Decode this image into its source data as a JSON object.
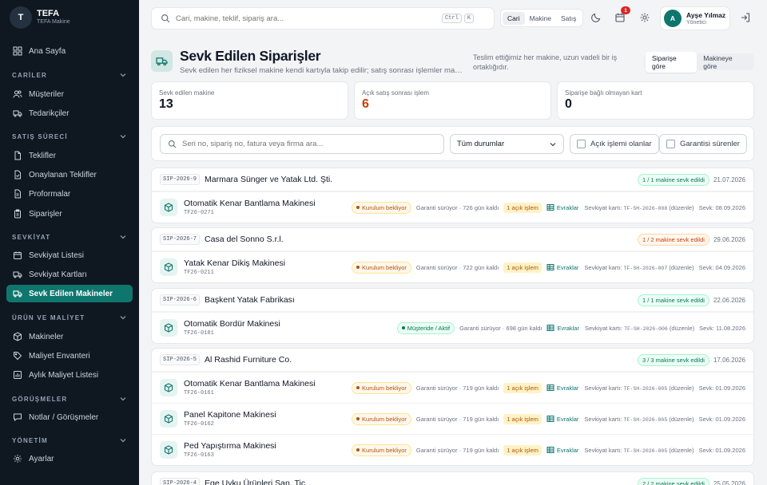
{
  "brand": {
    "logo": "T",
    "name": "TEFA",
    "sub": "TEFA Makine"
  },
  "sidebar": {
    "home": "Ana Sayfa",
    "sections": [
      {
        "title": "CARİLER",
        "items": [
          "Müşteriler",
          "Tedarikçiler"
        ]
      },
      {
        "title": "SATIŞ SÜRECİ",
        "items": [
          "Teklifler",
          "Onaylanan Teklifler",
          "Proformalar",
          "Siparişler"
        ]
      },
      {
        "title": "SEVKİYAT",
        "items": [
          "Sevkiyat Listesi",
          "Sevkiyat Kartları",
          "Sevk Edilen Makineler"
        ]
      },
      {
        "title": "ÜRÜN VE MALİYET",
        "items": [
          "Makineler",
          "Maliyet Envanteri",
          "Aylık Maliyet Listesi"
        ]
      },
      {
        "title": "GÖRÜŞMELER",
        "items": [
          "Notlar / Görüşmeler"
        ]
      },
      {
        "title": "YÖNETİM",
        "items": [
          "Ayarlar"
        ]
      }
    ],
    "active": "Sevk Edilen Makineler"
  },
  "topbar": {
    "search_placeholder": "Cari, makine, teklif, sipariş ara...",
    "kbd": [
      "Ctrl",
      "K"
    ],
    "scopes": [
      "Cari",
      "Makine",
      "Satış"
    ],
    "notifications": "1",
    "user": {
      "initial": "A",
      "name": "Ayşe Yılmaz",
      "role": "Yönetici"
    }
  },
  "page": {
    "title": "Sevk Edilen Siparişler",
    "subtitle": "Sevk edilen her fiziksel makine kendi kartıyla takip edilir; satış sonrası işlemler makine ...",
    "note": "Teslim ettiğimiz her makine, uzun vadeli bir iş ortaklığıdır.",
    "view_toggle": [
      "Siparişe göre",
      "Makineye göre"
    ]
  },
  "stats": [
    {
      "label": "Sevk edilen makine",
      "value": "13",
      "color": "#111827"
    },
    {
      "label": "Açık satış sonrası işlem",
      "value": "6",
      "color": "#c2410c"
    },
    {
      "label": "Siparişe bağlı olmayan kart",
      "value": "0",
      "color": "#111827"
    }
  ],
  "filters": {
    "search_placeholder": "Seri no, sipariş no, fatura veya firma ara...",
    "status": "Tüm durumlar",
    "checks": [
      "Açık işlemi olanlar",
      "Garantisi sürenler"
    ]
  },
  "orders": [
    {
      "code": "SIP-2026-9",
      "customer": "Marmara Sünger ve Yatak Ltd. Şti.",
      "shipped": "1 / 1 makine sevk edildi",
      "tone": "green",
      "date": "21.07.2026",
      "machines": [
        {
          "name": "Otomatik Kenar Bantlama Makinesi",
          "code": "TF26-0271",
          "status": "Kurulum bekliyor",
          "status_type": "waiting",
          "warranty": "Garanti sürüyor · 726 gün kaldı",
          "ops": "1 açık işlem",
          "docs": "Evraklar",
          "card_label": "Sevkiyat kartı:",
          "card_code": "TF-SH-2026-008",
          "card_edit": "(düzenle)",
          "ship": "Sevk: 08.09.2026"
        }
      ]
    },
    {
      "code": "SIP-2026-7",
      "customer": "Casa del Sonno S.r.l.",
      "shipped": "1 / 2 makine sevk edildi",
      "tone": "orange",
      "date": "29.06.2026",
      "machines": [
        {
          "name": "Yatak Kenar Dikiş Makinesi",
          "code": "TF26-0211",
          "status": "Kurulum bekliyor",
          "status_type": "waiting",
          "warranty": "Garanti sürüyor · 722 gün kaldı",
          "ops": "1 açık işlem",
          "docs": "Evraklar",
          "card_label": "Sevkiyat kartı:",
          "card_code": "TF-SH-2026-007",
          "card_edit": "(düzenle)",
          "ship": "Sevk: 04.09.2026"
        }
      ]
    },
    {
      "code": "SIP-2026-6",
      "customer": "Başkent Yatak Fabrikası",
      "shipped": "1 / 1 makine sevk edildi",
      "tone": "green",
      "date": "22.06.2026",
      "machines": [
        {
          "name": "Otomatik Bordür Makinesi",
          "code": "TF26-0181",
          "status": "Müşteride / Aktif",
          "status_type": "active",
          "warranty": "Garanti sürüyor · 698 gün kaldı",
          "ops": "",
          "docs": "Evraklar",
          "card_label": "Sevkiyat kartı:",
          "card_code": "TF-SH-2026-006",
          "card_edit": "(düzenle)",
          "ship": "Sevk: 11.08.2026"
        }
      ]
    },
    {
      "code": "SIP-2026-5",
      "customer": "Al Rashid Furniture Co.",
      "shipped": "3 / 3 makine sevk edildi",
      "tone": "green",
      "date": "17.06.2026",
      "machines": [
        {
          "name": "Otomatik Kenar Bantlama Makinesi",
          "code": "TF26-0161",
          "status": "Kurulum bekliyor",
          "status_type": "waiting",
          "warranty": "Garanti sürüyor · 719 gün kaldı",
          "ops": "1 açık işlem",
          "docs": "Evraklar",
          "card_label": "Sevkiyat kartı:",
          "card_code": "TF-SH-2026-005",
          "card_edit": "(düzenle)",
          "ship": "Sevk: 01.09.2026"
        },
        {
          "name": "Panel Kapitone Makinesi",
          "code": "TF26-0162",
          "status": "Kurulum bekliyor",
          "status_type": "waiting",
          "warranty": "Garanti sürüyor · 719 gün kaldı",
          "ops": "1 açık işlem",
          "docs": "Evraklar",
          "card_label": "Sevkiyat kartı:",
          "card_code": "TF-SH-2026-005",
          "card_edit": "(düzenle)",
          "ship": "Sevk: 01.09.2026"
        },
        {
          "name": "Ped Yapıştırma Makinesi",
          "code": "TF26-0163",
          "status": "Kurulum bekliyor",
          "status_type": "waiting",
          "warranty": "Garanti sürüyor · 719 gün kaldı",
          "ops": "1 açık işlem",
          "docs": "Evraklar",
          "card_label": "Sevkiyat kartı:",
          "card_code": "TF-SH-2026-005",
          "card_edit": "(düzenle)",
          "ship": "Sevk: 01.09.2026"
        }
      ]
    },
    {
      "code": "SIP-2026-4",
      "customer": "Ege Uyku Ürünleri San. Tic.",
      "shipped": "2 / 2 makine sevk edildi",
      "tone": "green",
      "date": "25.05.2026",
      "machines": []
    }
  ]
}
